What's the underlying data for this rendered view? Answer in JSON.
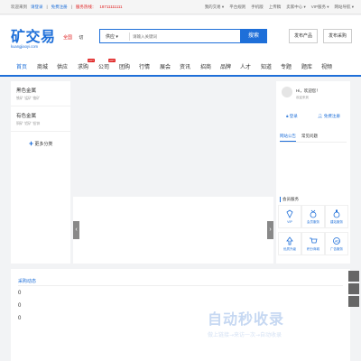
{
  "topbar": {
    "welcome": "欢迎来到",
    "login": "请登录",
    "register": "免费注册",
    "hotline_label": "服务热线：",
    "hotline": "18711111111",
    "links": [
      "我的交易 ▾",
      "平台规则",
      "手机版",
      "上传稿",
      "卖家中心 ▾",
      "VIP服务 ▾",
      "网站导航 ▾"
    ]
  },
  "header": {
    "logo_cn": "矿交易",
    "logo_en": "kuangjiaoyi.com",
    "city": "全国",
    "city_switch": "切",
    "search_category": "供应 ▾",
    "search_placeholder": "请输入关键词",
    "search_button": "搜索",
    "publish_product": "发布产品",
    "publish_purchase": "发布采购"
  },
  "nav": {
    "items": [
      "首页",
      "商城",
      "供应",
      "求购",
      "公司",
      "团购",
      "行情",
      "展会",
      "资讯",
      "招商",
      "品牌",
      "人才",
      "知道",
      "专题",
      "题库",
      "视频"
    ],
    "hot_badge": "HOT"
  },
  "left": {
    "categories": [
      {
        "title": "黑色金属",
        "sub": "铁矿 锰矿 铬矿"
      },
      {
        "title": "有色金属",
        "sub": "铜矿 铝矿 铅锌"
      }
    ],
    "more": "更多分类"
  },
  "right": {
    "hello": "Hi，欢迎您！",
    "welcome": "欢迎来到",
    "login": "登录",
    "register": "免费注册",
    "tabs": [
      "网站公告",
      "常见问题"
    ],
    "services_title": "会员服务",
    "services": [
      "VIP",
      "会员服务",
      "建站服务",
      "优质升级",
      "积分商城",
      "广告服务"
    ]
  },
  "bottom": {
    "title": "采购动态",
    "values": [
      "0",
      "0",
      "0"
    ]
  },
  "watermark": {
    "main": "自动秒收录",
    "sub": "做上链接→来访一次→自动收录"
  },
  "colors": {
    "accent": "#1e6fd9",
    "hot": "#e02020"
  }
}
